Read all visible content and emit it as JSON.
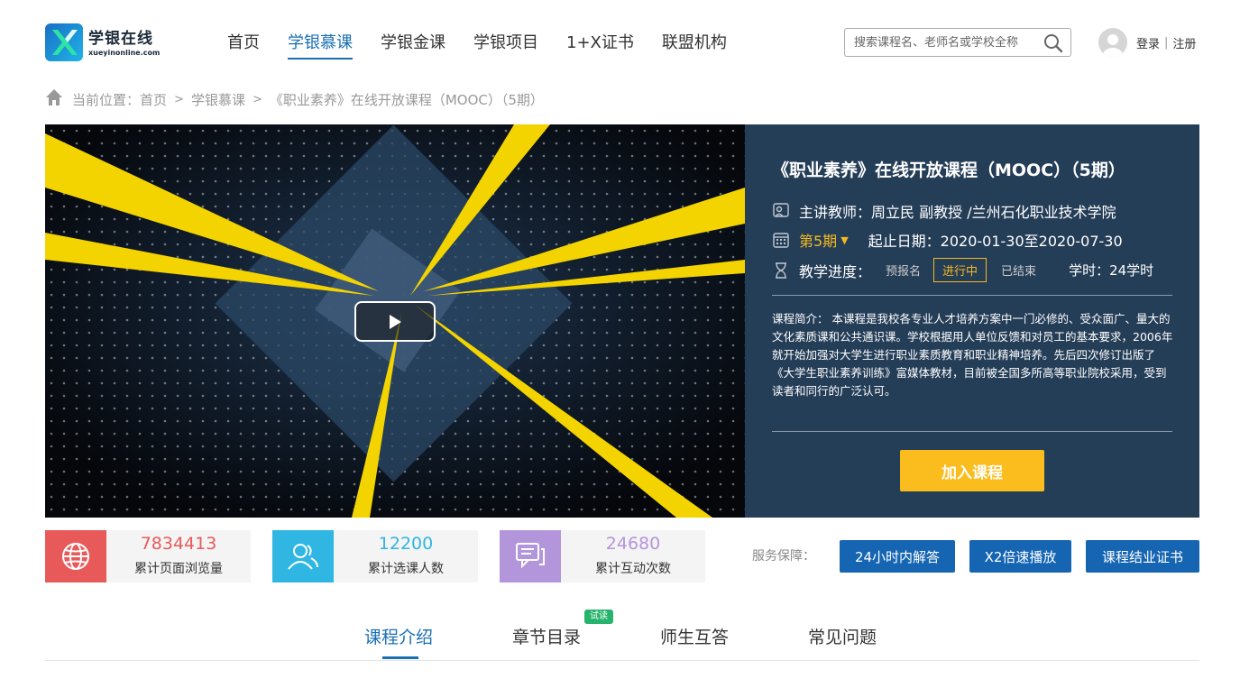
{
  "header": {
    "logo_cn": "学银在线",
    "logo_en": "xueyinonline.com",
    "nav": [
      "首页",
      "学银慕课",
      "学银金课",
      "学银项目",
      "1+X证书",
      "联盟机构"
    ],
    "active_nav": "学银慕课",
    "search_placeholder": "搜索课程名、老师名或学校全称",
    "login": "登录",
    "separator": "|",
    "register": "注册"
  },
  "breadcrumb": {
    "prefix": "当前位置：",
    "items": [
      "首页",
      "学银慕课",
      "《职业素养》在线开放课程（MOOC）（5期）"
    ],
    "arrow": ">"
  },
  "course": {
    "title": "《职业素养》在线开放课程（MOOC）（5期）",
    "teacher_label": "主讲教师：",
    "teacher": "周立民 副教授 /兰州石化职业技术学院",
    "term": "第5期",
    "date_label": "起止日期：",
    "dates": "2020-01-30至2020-07-30",
    "progress_label": "教学进度：",
    "stages": [
      "预报名",
      "进行中",
      "已结束"
    ],
    "current_stage": "进行中",
    "hours_label": "学时：",
    "hours": "24学时",
    "description": "课程简介： 本课程是我校各专业人才培养方案中一门必修的、受众面广、量大的文化素质课和公共通识课。学校根据用人单位反馈和对员工的基本要求，2006年就开始加强对大学生进行职业素质教育和职业精神培养。先后四次修订出版了《大学生职业素养训练》富媒体教材，目前被全国多所高等职业院校采用，受到读者和同行的广泛认可。",
    "join_button": "加入课程"
  },
  "stats": [
    {
      "value": "7834413",
      "label": "累计页面浏览量",
      "color": "#e85a5a",
      "icon": "globe-icon"
    },
    {
      "value": "12200",
      "label": "累计选课人数",
      "color": "#2fb6e3",
      "icon": "users-icon"
    },
    {
      "value": "24680",
      "label": "累计互动次数",
      "color": "#b395dc",
      "icon": "chat-icon"
    }
  ],
  "service": {
    "label": "服务保障：",
    "buttons": [
      "24小时内解答",
      "X2倍速播放",
      "课程结业证书"
    ]
  },
  "tabs": {
    "items": [
      "课程介绍",
      "章节目录",
      "师生互答",
      "常见问题"
    ],
    "active": "课程介绍",
    "badge": "试读"
  },
  "colors": {
    "accent": "#1a6fb5",
    "info_bg": "#253e58",
    "join": "#fbbd1e",
    "service_btn": "#1565b3",
    "badge": "#26b36b"
  }
}
